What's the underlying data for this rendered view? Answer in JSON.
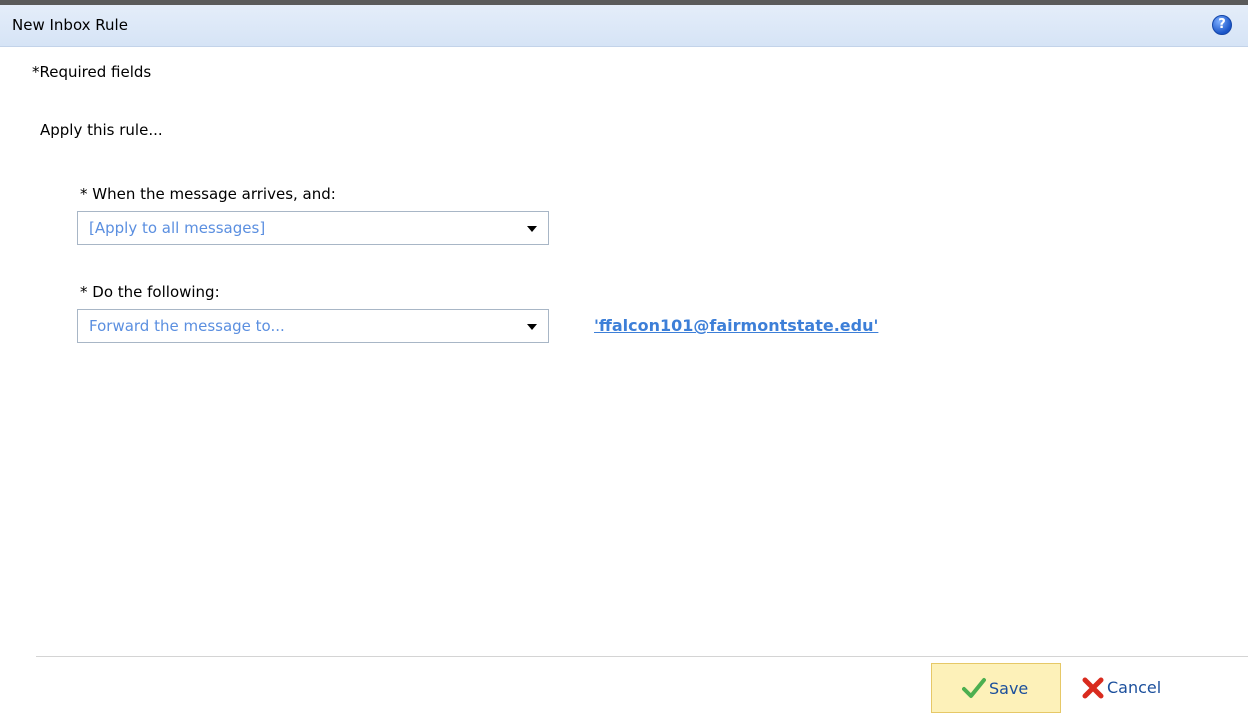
{
  "window": {
    "title": "New Inbox Rule",
    "help_symbol": "?"
  },
  "form": {
    "required_note": "*Required fields",
    "apply_title": "Apply this rule...",
    "condition": {
      "label": "* When the message arrives, and:",
      "selected": "[Apply to all messages]"
    },
    "action": {
      "label": "* Do the following:",
      "selected": "Forward the message to...",
      "recipient": "'ffalcon101@fairmontstate.edu'"
    }
  },
  "footer": {
    "save_label": "Save",
    "cancel_label": "Cancel"
  },
  "colors": {
    "title_bar": "#d6e4f6",
    "link": "#3d7fd8",
    "select_text": "#5b8fe0",
    "save_highlight": "#fdf1b9",
    "save_check": "#4caf50",
    "cancel_x": "#d92b1e"
  },
  "icons": {
    "help": "help-icon",
    "dropdown": "chevron-down-icon",
    "save": "checkmark-icon",
    "cancel": "close-icon"
  }
}
